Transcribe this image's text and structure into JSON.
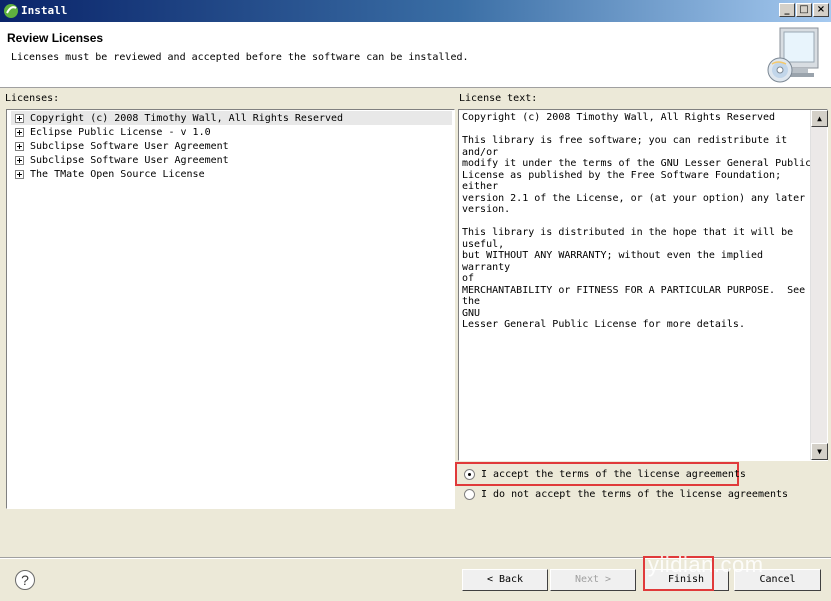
{
  "window": {
    "title": "Install",
    "controls": [
      "_",
      "□",
      "×"
    ],
    "icon": "eclipse-install-icon"
  },
  "header": {
    "title": "Review Licenses",
    "description": "Licenses must be reviewed and accepted before the software can be installed.",
    "banner_icon": "cd-computer-icon"
  },
  "licenses": {
    "label": "Licenses:",
    "items": [
      {
        "label": "Copyright (c) 2008 Timothy Wall, All Rights Reserved",
        "selected": true
      },
      {
        "label": "Eclipse Public License - v 1.0"
      },
      {
        "label": "Subclipse Software User Agreement"
      },
      {
        "label": "Subclipse Software User Agreement"
      },
      {
        "label": "The TMate Open Source License"
      }
    ]
  },
  "license_text": {
    "label": "License text:",
    "content": "Copyright (c) 2008 Timothy Wall, All Rights Reserved\n\nThis library is free software; you can redistribute it and/or\nmodify it under the terms of the GNU Lesser General Public\nLicense as published by the Free Software Foundation; either\nversion 2.1 of the License, or (at your option) any later\nversion.\n\nThis library is distributed in the hope that it will be\nuseful,\nbut WITHOUT ANY WARRANTY; without even the implied warranty\nof\nMERCHANTABILITY or FITNESS FOR A PARTICULAR PURPOSE.  See the\nGNU\nLesser General Public License for more details."
  },
  "agreement": {
    "accept_label": "I accept the terms of the license agreements",
    "decline_label": "I do not accept the terms of the license agreements",
    "selected": "accept"
  },
  "buttons": {
    "back": "< Back",
    "next": "Next >",
    "finish": "Finish",
    "cancel": "Cancel",
    "help": "?"
  },
  "watermark": "yiidian.com",
  "colors": {
    "highlight": "#e03a3a",
    "title_gradient_start": "#0a246a",
    "title_gradient_end": "#a6caf0"
  }
}
